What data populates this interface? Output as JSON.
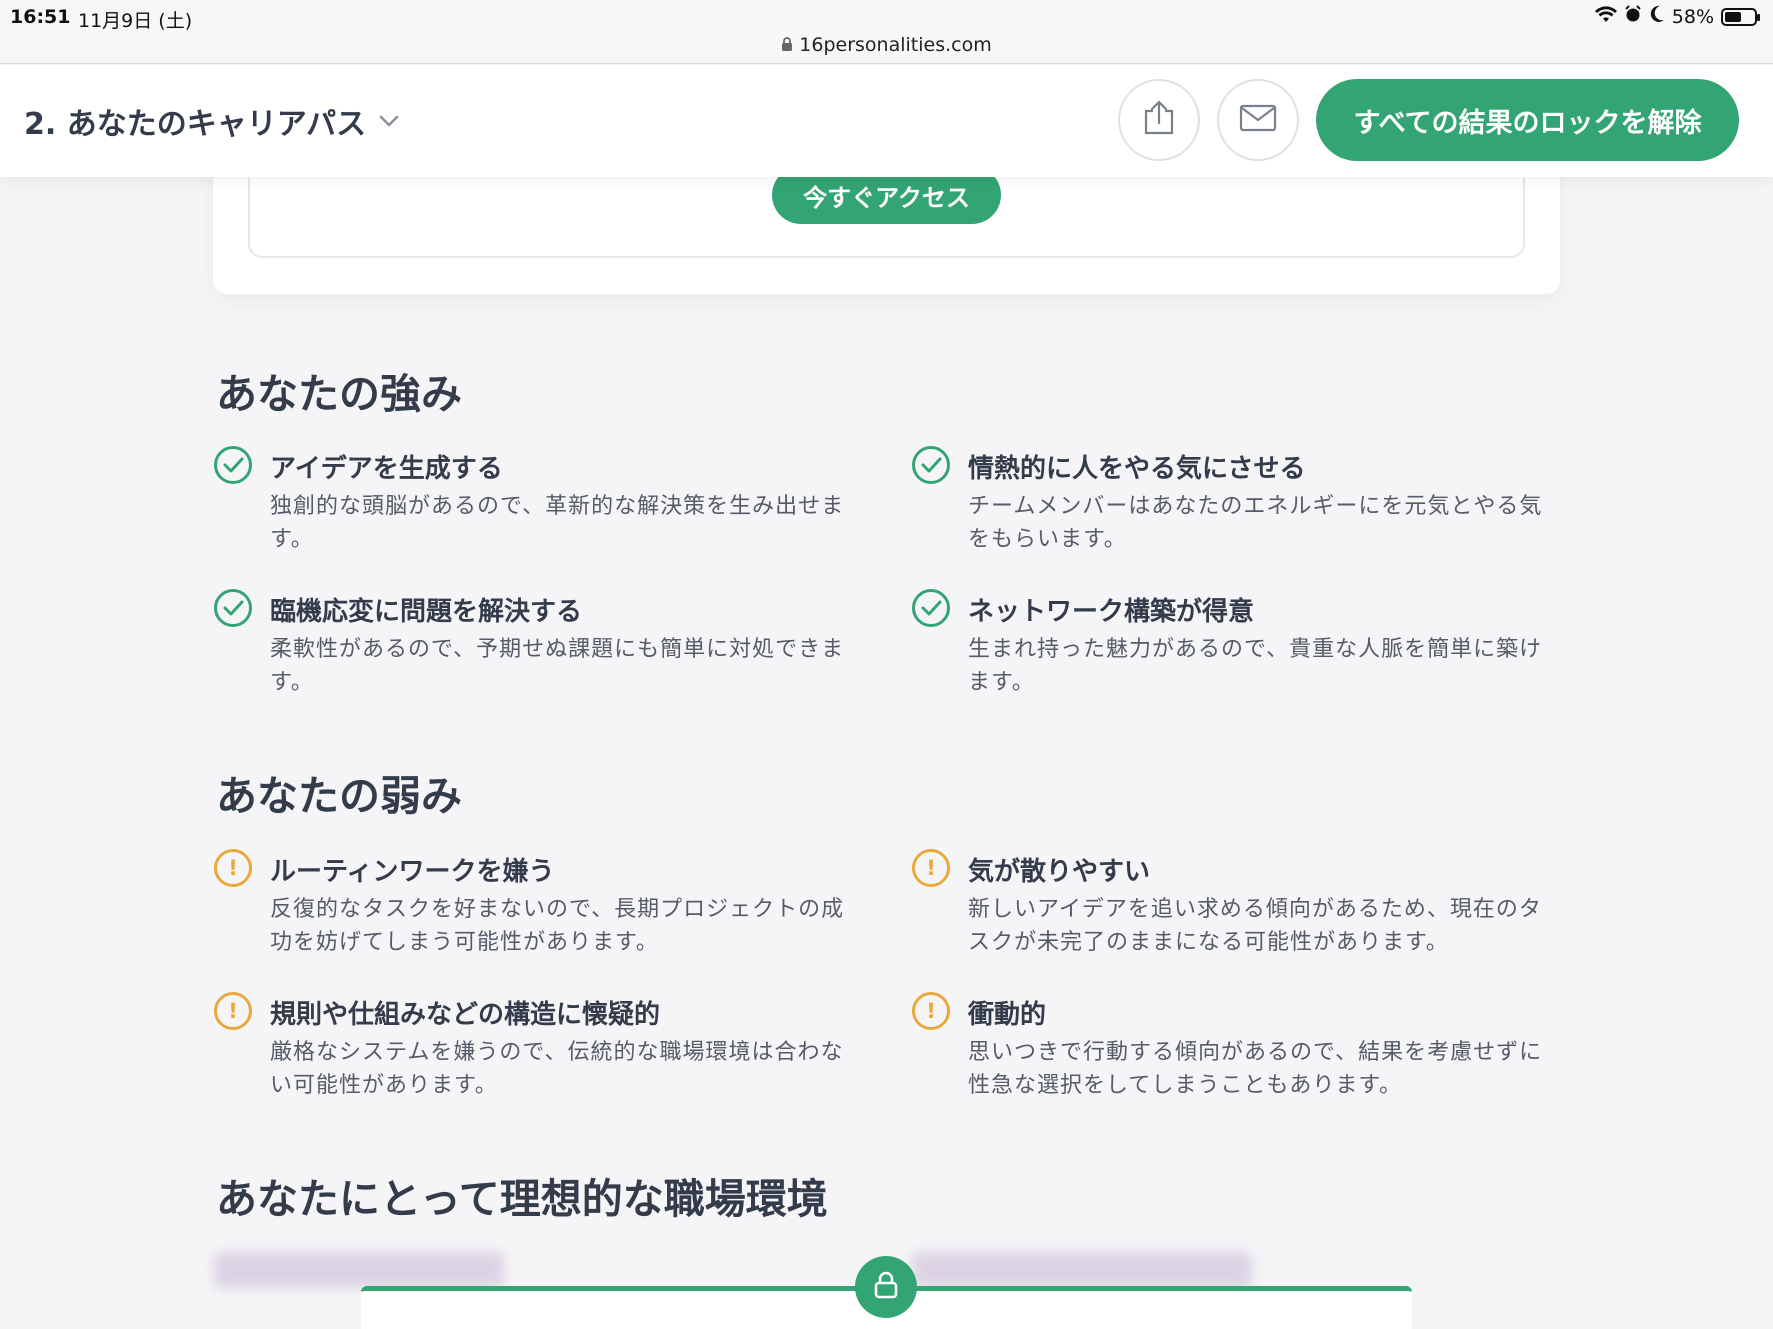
{
  "status_bar": {
    "time": "16:51",
    "date": "11月9日 (土)",
    "url": "16personalities.com",
    "battery": "58%",
    "battery_level": 0.58
  },
  "header": {
    "section_select": "2. あなたのキャリアパス",
    "unlock_button": "すべての結果のロックを解除"
  },
  "card": {
    "access_button": "今すぐアクセス"
  },
  "strengths": {
    "title": "あなたの強み",
    "items": [
      {
        "title": "アイデアを生成する",
        "desc": "独創的な頭脳があるので、革新的な解決策を生み出せます。"
      },
      {
        "title": "情熱的に人をやる気にさせる",
        "desc": "チームメンバーはあなたのエネルギーにを元気とやる気をもらいます。"
      },
      {
        "title": "臨機応変に問題を解決する",
        "desc": "柔軟性があるので、予期せぬ課題にも簡単に対処できます。"
      },
      {
        "title": "ネットワーク構築が得意",
        "desc": "生まれ持った魅力があるので、貴重な人脈を簡単に築けます。"
      }
    ]
  },
  "weaknesses": {
    "title": "あなたの弱み",
    "items": [
      {
        "title": "ルーティンワークを嫌う",
        "desc": "反復的なタスクを好まないので、長期プロジェクトの成功を妨げてしまう可能性があります。"
      },
      {
        "title": "気が散りやすい",
        "desc": "新しいアイデアを追い求める傾向があるため、現在のタスクが未完了のままになる可能性があります。"
      },
      {
        "title": "規則や仕組みなどの構造に懐疑的",
        "desc": "厳格なシステムを嫌うので、伝統的な職場環境は合わない可能性があります。"
      },
      {
        "title": "衝動的",
        "desc": "思いつきで行動する傾向があるので、結果を考慮せずに性急な選択をしてしまうこともあります。"
      }
    ]
  },
  "workplace": {
    "title": "あなたにとって理想的な職場環境"
  },
  "colors": {
    "accent": "#33a474",
    "warning": "#e8a93a",
    "text": "#343c4b"
  }
}
